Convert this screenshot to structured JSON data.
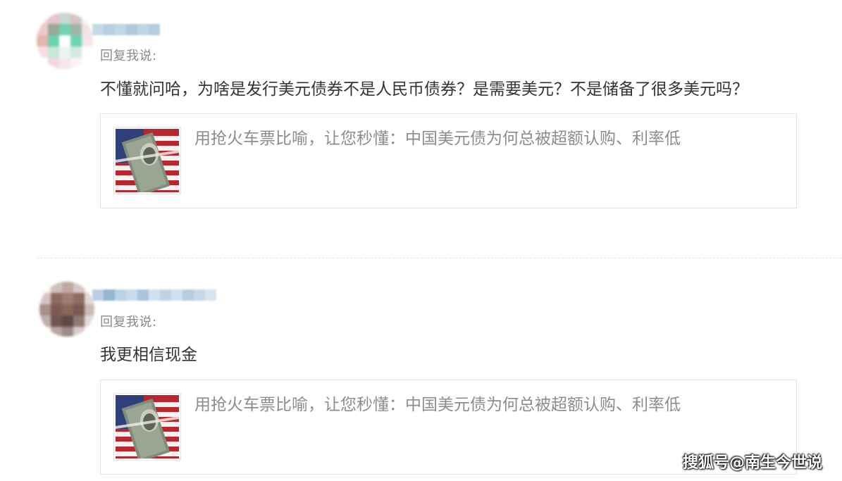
{
  "comments": [
    {
      "reply_label": "回复我说:",
      "text": "不懂就问哈，为啥是发行美元债券不是人民币债券？是需要美元？不是储备了很多美元吗？",
      "link_card": {
        "title": "用抢火车票比喻，让您秒懂：中国美元债为何总被超额认购、利率低",
        "thumbnail_icon": "dollar-bill-flag-thumbnail"
      }
    },
    {
      "reply_label": "回复我说:",
      "text": "我更相信现金",
      "link_card": {
        "title": "用抢火车票比喻，让您秒懂：中国美元债为何总被超额认购、利率低",
        "thumbnail_icon": "dollar-bill-flag-thumbnail"
      }
    }
  ],
  "watermark": "搜狐号@南生今世说",
  "colors": {
    "text_primary": "#333333",
    "text_secondary": "#8a8a8a",
    "card_border": "#e3e3e3"
  }
}
